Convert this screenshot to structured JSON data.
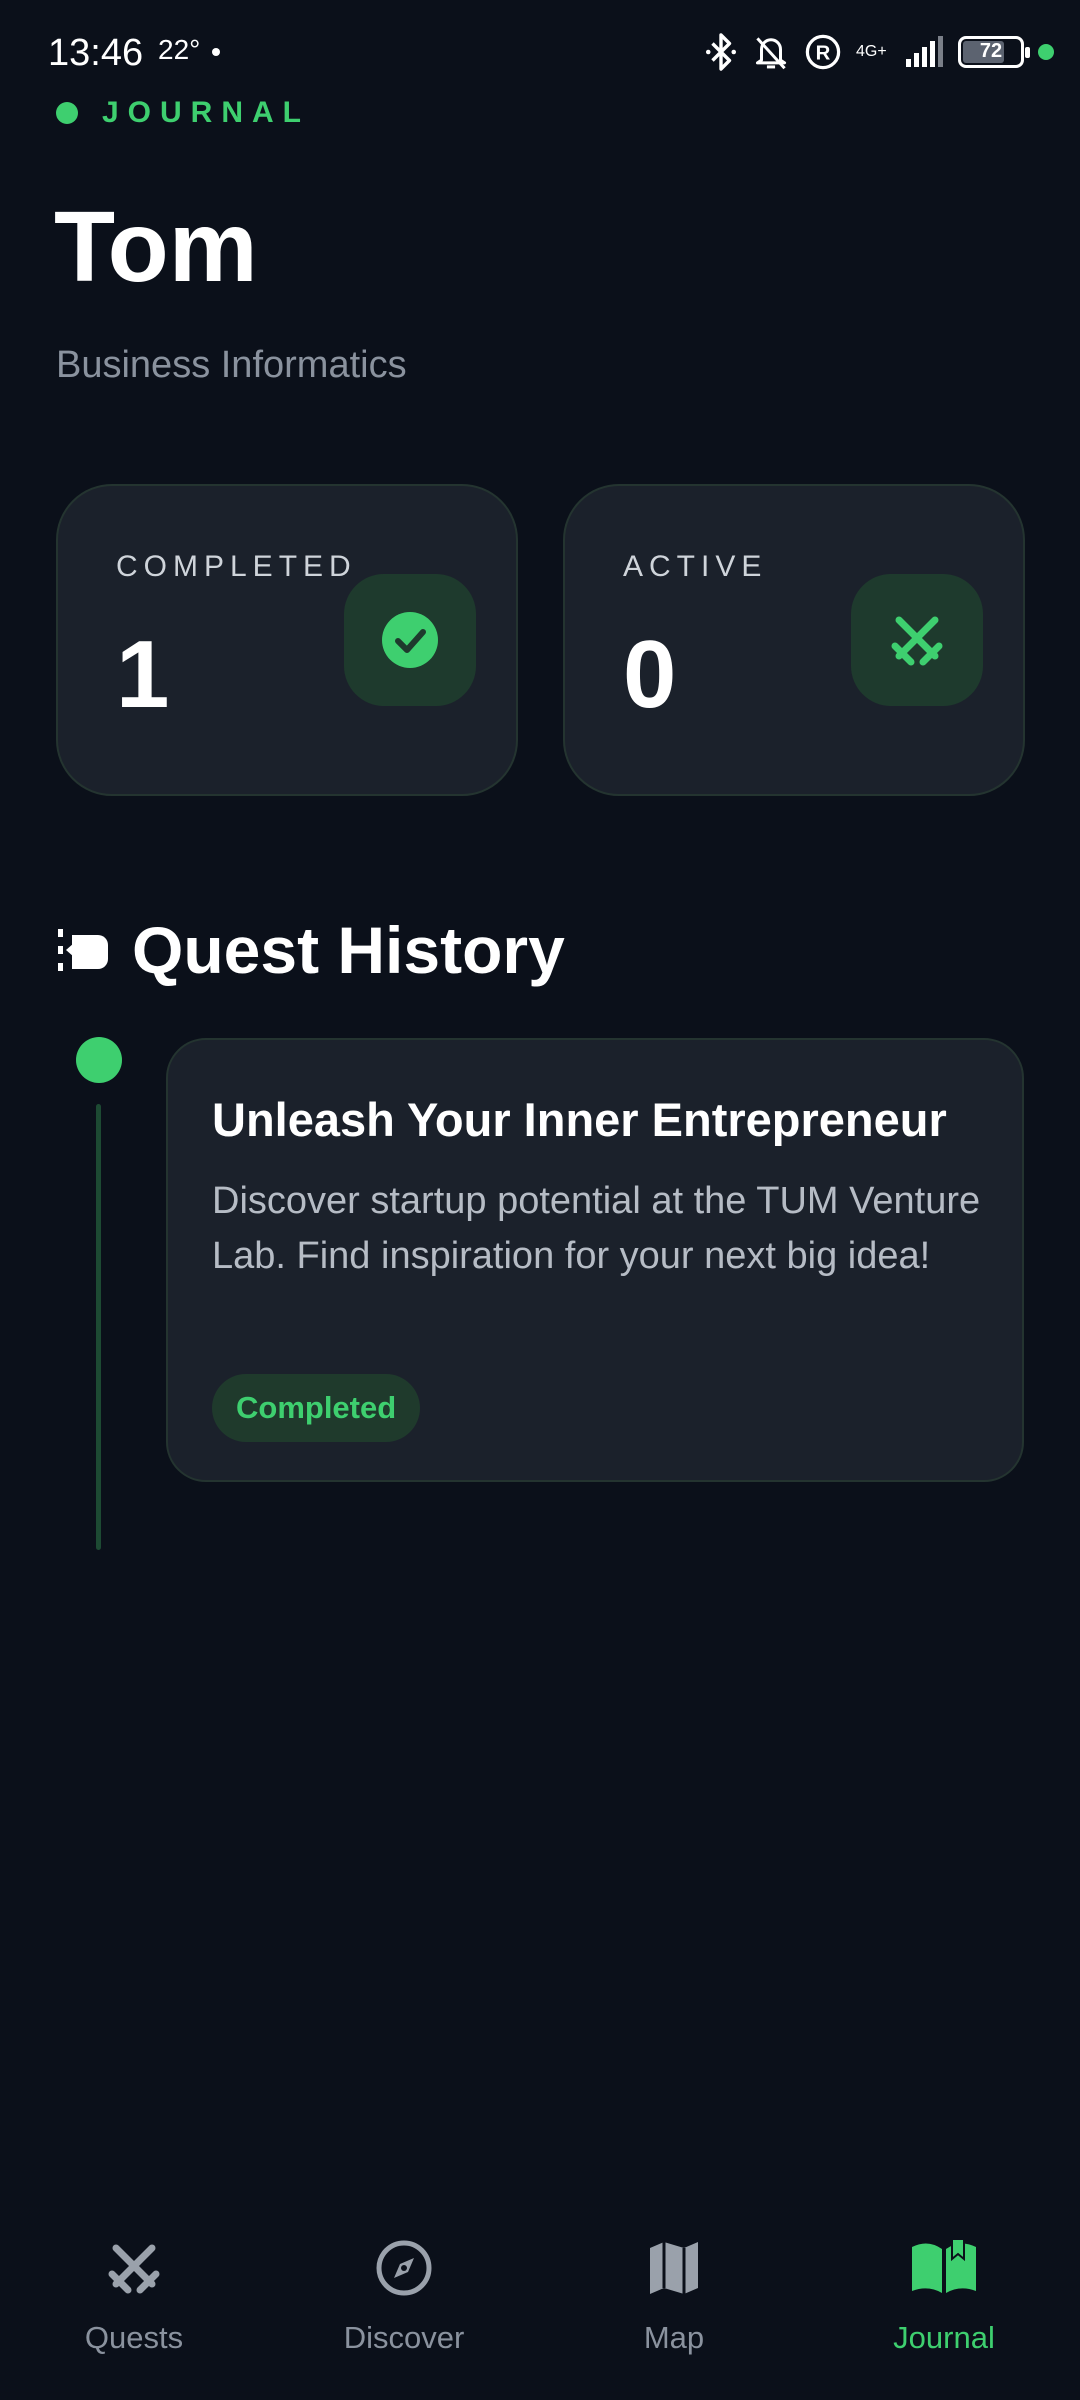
{
  "status_bar": {
    "time": "13:46",
    "temperature": "22°",
    "network": "4G+",
    "battery": "72",
    "battery_level_percent": 72
  },
  "header": {
    "section_label": "JOURNAL",
    "user_name": "Tom",
    "user_subtitle": "Business Informatics"
  },
  "stats": {
    "completed": {
      "label": "COMPLETED",
      "value": "1",
      "icon": "check-circle-icon"
    },
    "active": {
      "label": "ACTIVE",
      "value": "0",
      "icon": "crossed-swords-icon"
    }
  },
  "quest_history": {
    "title": "Quest History",
    "icon": "timeline-icon",
    "items": [
      {
        "title": "Unleash Your Inner Entrepreneur",
        "description": "Discover startup potential at the TUM Venture Lab. Find inspiration for your next big idea!",
        "status": "Completed"
      }
    ]
  },
  "bottom_nav": {
    "items": [
      {
        "label": "Quests",
        "icon": "crossed-swords-icon"
      },
      {
        "label": "Discover",
        "icon": "compass-icon"
      },
      {
        "label": "Map",
        "icon": "map-icon"
      },
      {
        "label": "Journal",
        "icon": "book-open-icon"
      }
    ],
    "active": "Journal"
  },
  "colors": {
    "background": "#0b101a",
    "card": "#1b212b",
    "accent": "#3ecf6f",
    "muted_text": "#8a929e"
  }
}
